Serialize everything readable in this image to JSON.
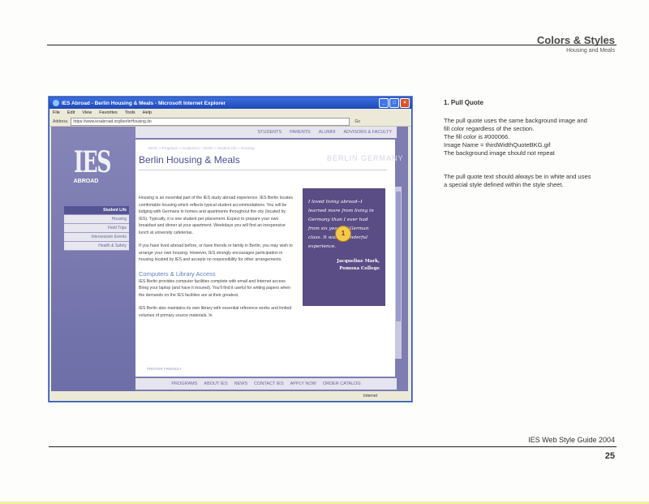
{
  "header": {
    "title": "Colors & Styles",
    "subtitle": "Housing and Meals"
  },
  "footer": {
    "guide": "IES Web Style Guide 2004",
    "page": "25"
  },
  "notes": {
    "heading": "1. Pull Quote",
    "p1": [
      "The pull quote uses the same background image and",
      "fill color regardless of the section.",
      "The fill color is #000066.",
      "Image Name = thirdWidthQuoteBKG.gif",
      "The background image should not repeat"
    ],
    "p2": [
      "The pull quote text should always be in white and uses",
      "a special style defined within the style sheet."
    ]
  },
  "browser": {
    "title": "IES Abroad - Berlin Housing & Meals - Microsoft Internet Explorer",
    "menu": [
      "File",
      "Edit",
      "View",
      "Favorites",
      "Tools",
      "Help"
    ],
    "address_label": "Address",
    "address": "https://www.iesabroad.org/berlinHousing.do",
    "go": "Go",
    "status_zone": "Internet"
  },
  "site": {
    "logo": "IES",
    "logo_sub": "ABROAD",
    "topnav": [
      "STUDENTS",
      "PARENTS",
      "ALUMNI",
      "ADVISORS & FACULTY"
    ],
    "sidenav": [
      "Student Life",
      "Housing",
      "Field Trips",
      "Intersession Events",
      "Health & Safety"
    ],
    "breadcrumbs": "Berlin > Programs > Academics > Berlin > Student Life > Housing",
    "page_title": "Berlin Housing & Meals",
    "watermark": "BERLIN GERMANY",
    "body": {
      "p1": "Housing is an essential part of the IES study abroad experience. IES Berlin locates comfortable housing which reflects typical student accommodations. You will be lodging with Germans in homes and apartments throughout the city (located by IES). Typically, it is one student per placement. Expect to prepare your own breakfast and dinner at your apartment. Weekdays you will find an inexpensive lunch at university cafeterias.",
      "p2": "If you have lived abroad before, or have friends or family in Berlin, you may wish to arrange your own housing. However, IES strongly encourages participation in housing located by IES and accepts no responsibility for other arrangements.",
      "h2": "Computers & Library Access",
      "p3": "IES Berlin provides computer facilities complete with email and Internet access. Bring your laptop (and have it insured). You'll find it useful for writing papers when the demands on the IES facilities are at their greatest.",
      "p4": "IES Berlin also maintains its own library with essential reference works and limited volumes of primary source materials. In"
    },
    "quote": {
      "text": "I loved living abroad--I learned more from living in Germany than I ever had from six years of German class. It was a wonderful experience.",
      "author": "Jacqueline Mark,",
      "school": "Pomona College"
    },
    "marker": "1",
    "printer": "PRINTER FRIENDLY",
    "botnav": [
      "PROGRAMS",
      "ABOUT IES",
      "NEWS",
      "CONTACT IES",
      "APPLY NOW",
      "ORDER CATALOG"
    ]
  }
}
